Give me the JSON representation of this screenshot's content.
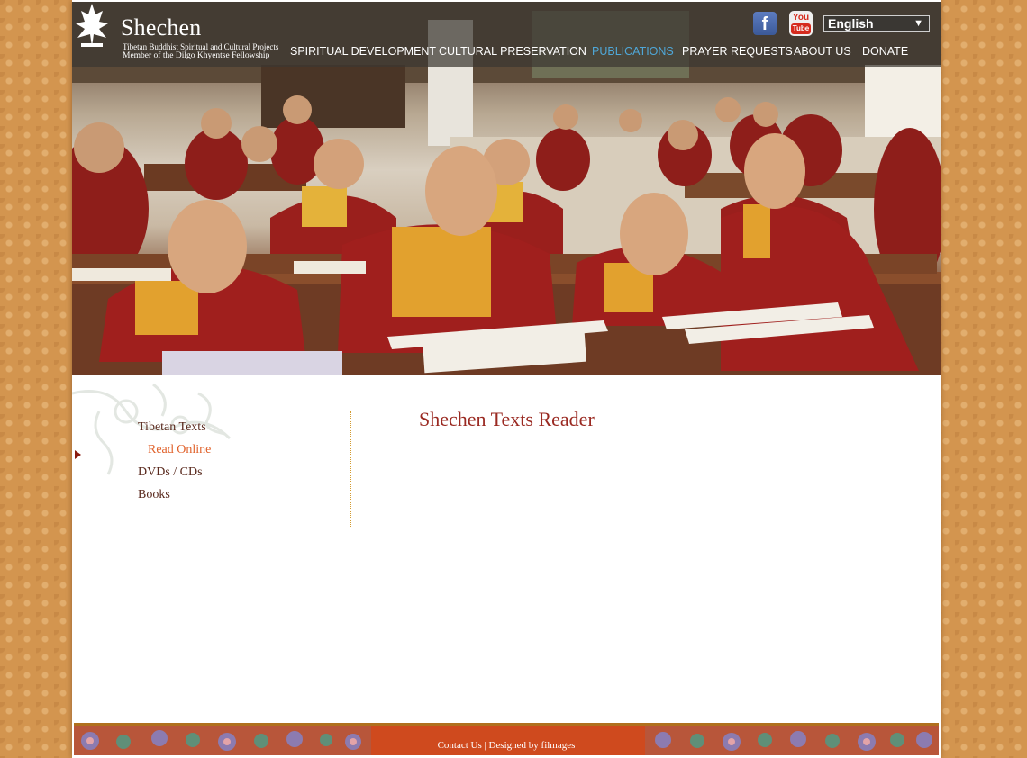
{
  "header": {
    "site_name": "Shechen",
    "tagline_1": "Tibetan Buddhist Spiritual and Cultural Projects",
    "tagline_2": "Member of the Dilgo Khyentse Fellowship",
    "language": "English",
    "social": {
      "facebook_glyph": "f",
      "youtube_top": "You",
      "youtube_bottom": "Tube"
    },
    "nav": [
      {
        "label": "SPIRITUAL DEVELOPMENT",
        "active": false
      },
      {
        "label": "CULTURAL PRESERVATION",
        "active": false
      },
      {
        "label": "PUBLICATIONS",
        "active": true
      },
      {
        "label": "PRAYER REQUESTS",
        "active": false
      },
      {
        "label": "ABOUT US",
        "active": false
      },
      {
        "label": "DONATE",
        "active": false
      }
    ]
  },
  "sidebar": {
    "items": [
      {
        "label": "Tibetan Texts",
        "active": false
      },
      {
        "label": "Read Online",
        "active": true
      },
      {
        "label": "DVDs / CDs",
        "active": false
      },
      {
        "label": "Books",
        "active": false
      }
    ]
  },
  "main": {
    "title": "Shechen Texts Reader"
  },
  "footer": {
    "contact": "Contact Us",
    "separator": "|",
    "designed": "Designed by filmages"
  },
  "colors": {
    "nav_active": "#4fa7d8",
    "title": "#9a2a22",
    "sidebar_active": "#e0612a",
    "footer_band": "#cf4a1e",
    "page_bg": "#d3954f"
  }
}
